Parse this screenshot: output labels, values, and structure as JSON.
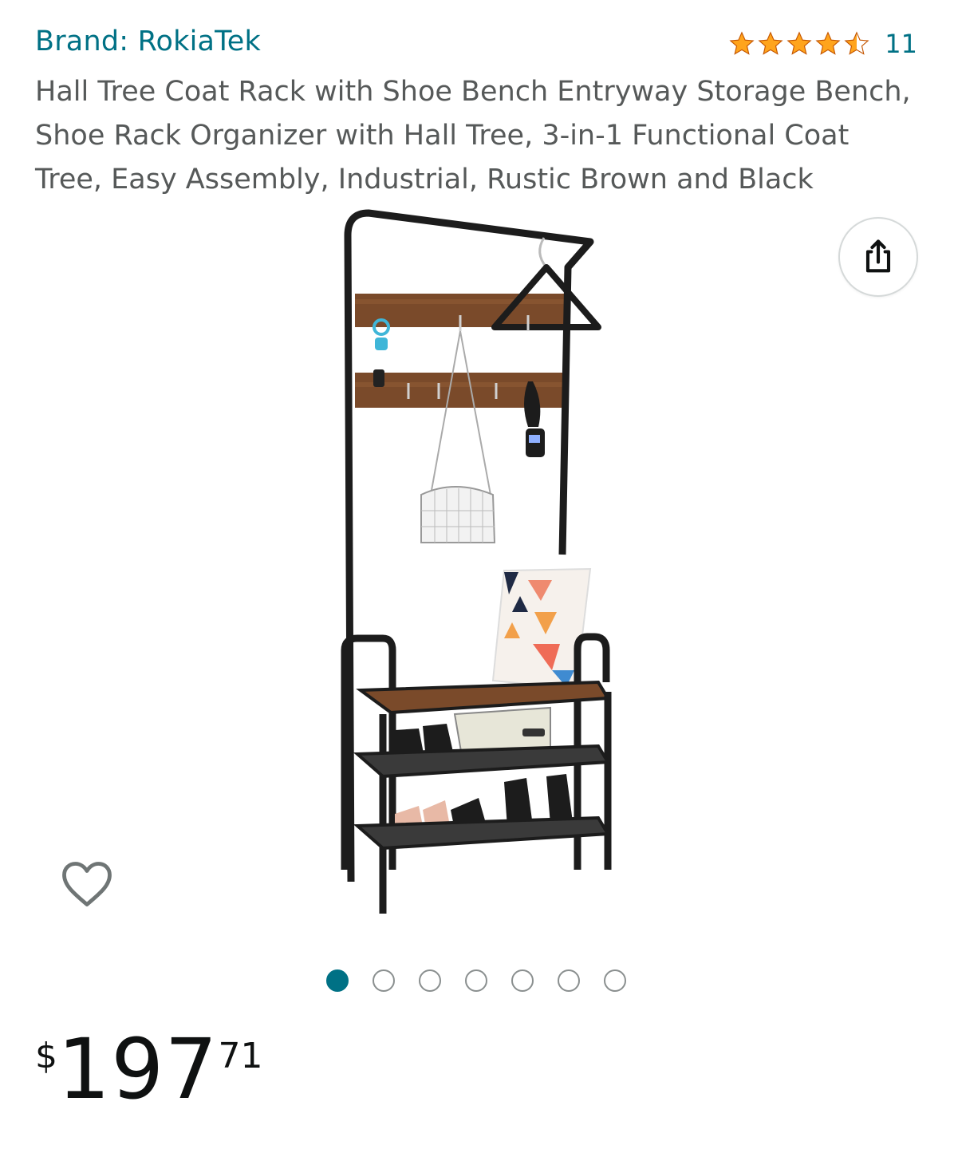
{
  "brand": {
    "label": "Brand: RokiaTek"
  },
  "rating": {
    "stars": 4.5,
    "count": "11",
    "star_color": "#FFA41C"
  },
  "product": {
    "title": "Hall Tree Coat Rack with Shoe Bench Entryway Storage Bench, Shoe Rack Organizer with Hall Tree, 3-in-1 Functional Coat Tree, Easy Assembly, Industrial, Rustic Brown and Black"
  },
  "gallery": {
    "image_count": 7,
    "active_index": 0
  },
  "price": {
    "symbol": "$",
    "whole": "197",
    "fraction": "71"
  },
  "icons": {
    "share": "share-icon",
    "wishlist": "heart-outline-icon"
  },
  "colors": {
    "link": "#007185",
    "text": "#565959",
    "price": "#0F1111"
  }
}
